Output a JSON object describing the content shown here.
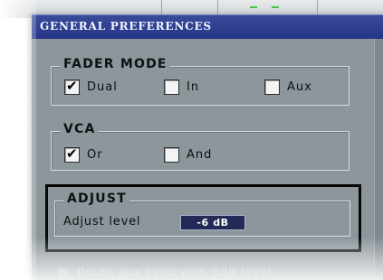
{
  "window": {
    "title": "GENERAL PREFERENCES"
  },
  "fader_mode": {
    "title": "FADER MODE",
    "options": [
      {
        "label": "Dual",
        "checked": true
      },
      {
        "label": "In",
        "checked": false
      },
      {
        "label": "Aux",
        "checked": false
      }
    ]
  },
  "vca": {
    "title": "VCA",
    "options": [
      {
        "label": "Or",
        "checked": true
      },
      {
        "label": "And",
        "checked": false
      }
    ]
  },
  "adjust": {
    "title": "ADJUST",
    "label": "Adjust level",
    "value": "-6 dB"
  },
  "extra_option": {
    "label": "Route aux send with 0dB level",
    "checked": false
  },
  "check_glyph": "✔",
  "colors": {
    "titlebar": "#2f3f92",
    "panel": "#8c969b",
    "level_field": "#222a55",
    "accent_green": "#46c24a"
  }
}
